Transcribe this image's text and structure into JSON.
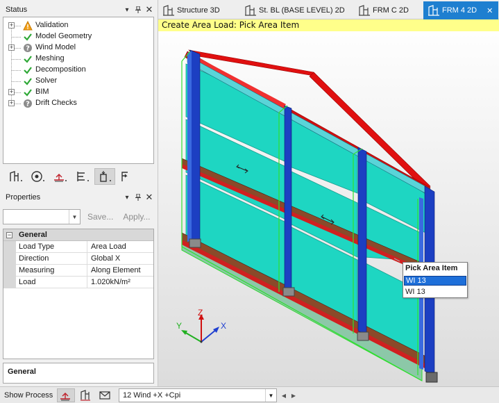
{
  "status_panel": {
    "title": "Status",
    "tree": [
      {
        "label": "Validation",
        "icon": "warning-icon",
        "expandable": true
      },
      {
        "label": "Model Geometry",
        "icon": "check-icon",
        "expandable": false
      },
      {
        "label": "Wind Model",
        "icon": "question-icon",
        "expandable": true
      },
      {
        "label": "Meshing",
        "icon": "check-icon",
        "expandable": false
      },
      {
        "label": "Decomposition",
        "icon": "check-icon",
        "expandable": false
      },
      {
        "label": "Solver",
        "icon": "check-icon",
        "expandable": false
      },
      {
        "label": "BIM",
        "icon": "check-icon",
        "expandable": true
      },
      {
        "label": "Drift Checks",
        "icon": "question-icon",
        "expandable": true
      }
    ]
  },
  "properties_panel": {
    "title": "Properties",
    "save_label": "Save...",
    "apply_label": "Apply...",
    "section": "General",
    "rows": [
      {
        "name": "Load Type",
        "value": "Area Load"
      },
      {
        "name": "Direction",
        "value": "Global X"
      },
      {
        "name": "Measuring",
        "value": "Along Element"
      },
      {
        "name": "Load",
        "value": "1.020kN/m²"
      }
    ],
    "description_title": "General"
  },
  "tabs": [
    {
      "label": "Structure 3D",
      "active": false
    },
    {
      "label": "St. BL (BASE LEVEL) 2D",
      "active": false
    },
    {
      "label": "FRM C 2D",
      "active": false
    },
    {
      "label": "FRM 4 2D",
      "active": true
    }
  ],
  "command_prompt": "Create Area Load: Pick Area Item",
  "pick_menu": {
    "title": "Pick Area Item",
    "items": [
      "WI 13",
      "WI 13"
    ]
  },
  "axes": {
    "x": "X",
    "y": "Y",
    "z": "Z"
  },
  "bottom_bar": {
    "show_process_label": "Show Process",
    "load_case": "12 Wind +X +Cpi"
  },
  "colors": {
    "accent": "#1e7fd0",
    "panel_fill": "#1ed6c2",
    "beam_red": "#e01010",
    "beam_brown": "#8a4a2a",
    "column_blue": "#1c3fc2",
    "highlight_green": "#30e030",
    "command_bg": "#ffff8a"
  }
}
